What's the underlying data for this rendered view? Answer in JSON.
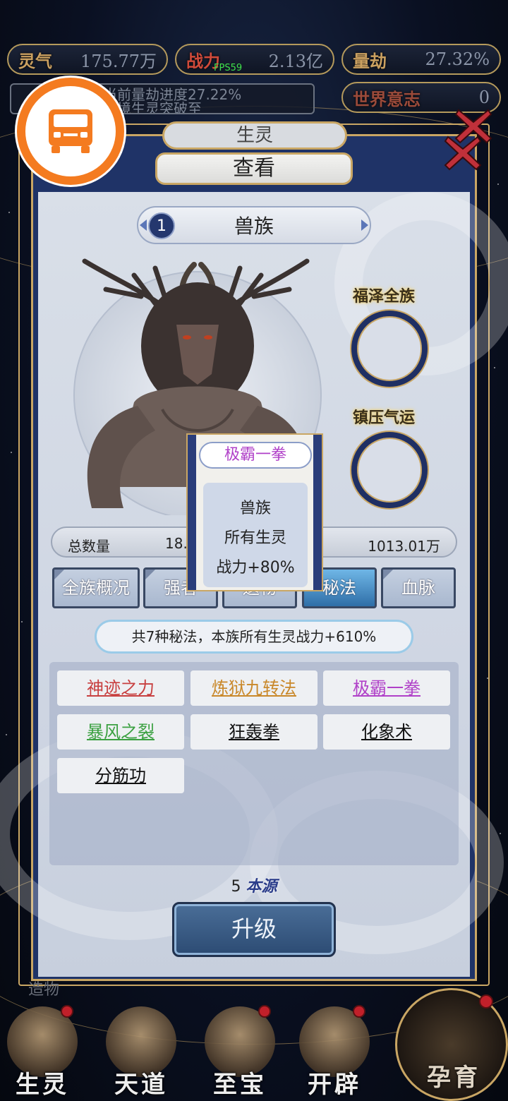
{
  "top_bar": {
    "resources": [
      {
        "label": "灵气",
        "value": "175.77万"
      },
      {
        "label": "战力",
        "value": "2.13亿"
      },
      {
        "label": "量劫",
        "value": "27.32%"
      },
      {
        "label": "世界意志",
        "value": "0"
      }
    ],
    "fps": "FPS59",
    "hint_line1": "当前量劫进度27.22%",
    "hint_line2": "仙境生灵突破至"
  },
  "panel": {
    "back_tab": "生灵",
    "title": "查看",
    "race_index": "1",
    "race_name": "兽族",
    "buffs": [
      "福泽全族",
      "镇压气运"
    ],
    "stats": {
      "label": "总数量",
      "count": "18.9",
      "power": "1013.01万"
    },
    "tabs": [
      "全族概况",
      "强者",
      "遗物",
      "秘法",
      "血脉"
    ],
    "active_tab": "秘法",
    "summary": "共7种秘法，本族所有生灵战力+610%",
    "arts": [
      {
        "name": "神迹之力",
        "color": "#c84040"
      },
      {
        "name": "炼狱九转法",
        "color": "#c9882a"
      },
      {
        "name": "极霸一拳",
        "color": "#b040c8"
      },
      {
        "name": "暴风之裂",
        "color": "#3aa040"
      },
      {
        "name": "狂轰拳",
        "color": "#111111"
      },
      {
        "name": "化象术",
        "color": "#111111"
      },
      {
        "name": "分筋功",
        "color": "#111111"
      }
    ],
    "cost_amount": "5",
    "cost_resource": "本源",
    "upgrade_label": "升级"
  },
  "tooltip": {
    "title": "极霸一拳",
    "title_color": "#b040c8",
    "lines": [
      "兽族",
      "所有生灵",
      "战力+80%"
    ]
  },
  "bottom_nav": {
    "items": [
      "生灵",
      "天道",
      "至宝",
      "开辟"
    ],
    "breed": "孕育",
    "creation_label": "造物"
  },
  "colors": {
    "accent_gold": "#c9a664",
    "panel_navy": "#1f3367",
    "badge_orange": "#f47b20"
  }
}
